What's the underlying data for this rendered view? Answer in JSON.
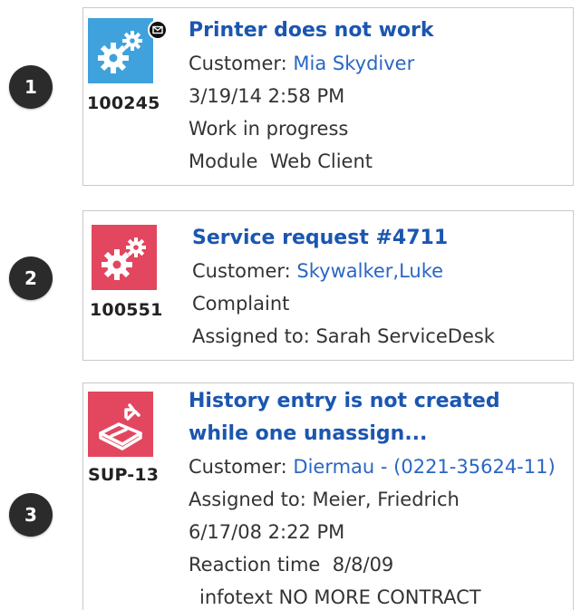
{
  "colors": {
    "link": "#2a66c4",
    "title": "#1b56b0",
    "tile_blue": "#3fa2dc",
    "tile_red": "#e2475f",
    "badge": "#2b2b2b"
  },
  "steps": [
    "1",
    "2",
    "3"
  ],
  "cards": [
    {
      "icon": "gears-icon",
      "has_mail_badge": true,
      "id": "100245",
      "title": "Printer does not work",
      "customer_label": "Customer:",
      "customer_value": "Mia Skydiver",
      "datetime": "3/19/14 2:58 PM",
      "status": "Work in progress",
      "module_label": "Module",
      "module_value": "Web Client"
    },
    {
      "icon": "gears-icon",
      "id": "100551",
      "title": "Service request #4711",
      "customer_label": "Customer:",
      "customer_value": "Skywalker,Luke",
      "category": "Complaint",
      "assigned": "Assigned to: Sarah ServiceDesk"
    },
    {
      "icon": "tray-arrow-icon",
      "id": "SUP-13",
      "title_line1": "History entry is not created",
      "title_line2": "while one unassign...",
      "customer_label": "Customer:",
      "customer_value": "Diermau - (0221-35624-11)",
      "assigned": "Assigned to: Meier, Friedrich",
      "datetime": "6/17/08 2:22 PM",
      "reaction_label": "Reaction time",
      "reaction_value": "8/8/09",
      "infotext": "infotext NO MORE CONTRACT"
    }
  ]
}
